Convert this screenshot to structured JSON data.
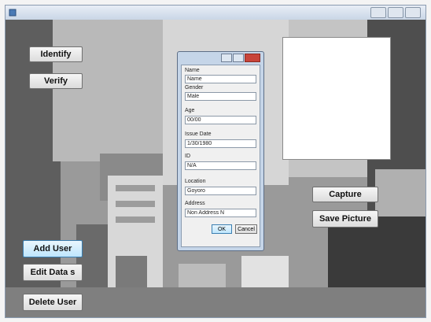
{
  "window": {
    "title": ""
  },
  "buttons": {
    "identify": "Identify",
    "verify": "Verify",
    "add_user": "Add User",
    "edit_data": "Edit Data s",
    "delete_user": "Delete User",
    "capture": "Capture",
    "save_picture": "Save Picture"
  },
  "dialog": {
    "title": "",
    "fields": [
      {
        "label": "Name",
        "value": "Name"
      },
      {
        "label": "Gender",
        "value": "Male"
      },
      {
        "label": "Age",
        "value": "00/00"
      },
      {
        "label": "Issue Date",
        "value": "1/30/1980"
      },
      {
        "label": "ID",
        "value": "N/A"
      },
      {
        "label": "Location",
        "value": "Goyoro"
      },
      {
        "label": "Address",
        "value": "Non Address N"
      }
    ],
    "ok": "OK",
    "cancel": "Cancel"
  },
  "colors": {
    "accent": "#3c7fb1",
    "close": "#c8443a"
  }
}
